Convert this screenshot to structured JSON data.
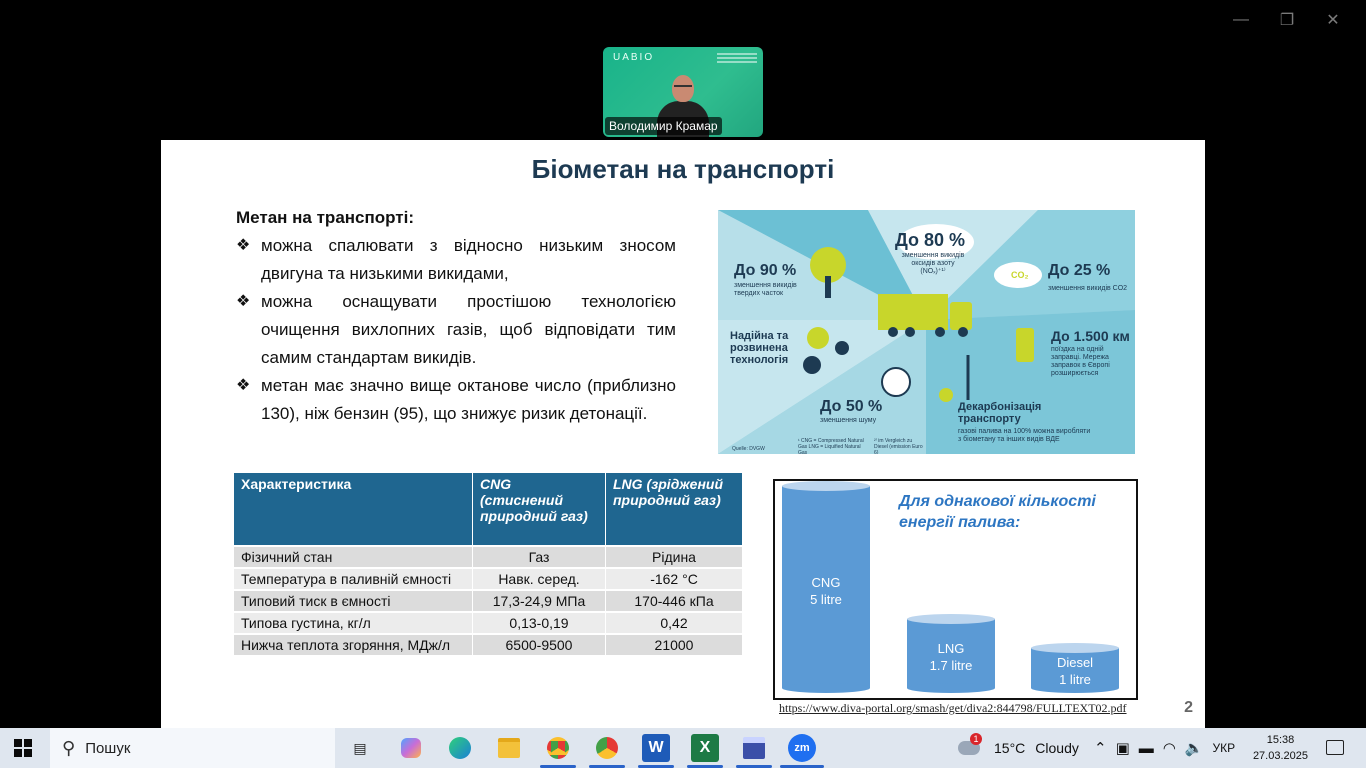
{
  "window": {
    "minimize": "—",
    "restore": "❐",
    "close": "✕"
  },
  "video": {
    "logo": "UABIO",
    "participant_name": "Володимир Крамар"
  },
  "slide": {
    "title": "Біометан на транспорті",
    "intro_heading": "Метан на транспорті:",
    "bullets": [
      "можна спалювати з відносно низьким зносом двигуна та низькими викидами,",
      "можна оснащувати простішою технологією очищення вихлопних газів, щоб відповідати тим самим стандартам викидів.",
      "метан має значно вище октанове число (приблизно 130), ніж бензин (95), що знижує ризик детонації."
    ],
    "bullet_mark": "❖",
    "infographic": {
      "particles_value": "До 90 %",
      "particles_label": "зменшення викидів твердих часток",
      "nox_value": "До 80 %",
      "nox_label": "зменшення викидів оксидів азоту (NOₓ)⁺¹⁾",
      "co2_value": "До 25 %",
      "co2_label": "зменшення викидів CO2",
      "co2_cloud": "CO₂",
      "tech_label": "Надійна та розвинена технологія",
      "range_value": "До 1.500 км",
      "range_label": "поїздка на одній заправці. Мережа заправок в Європі розширюється",
      "noise_value": "До 50 %",
      "noise_label": "зменшення шуму",
      "decarb_title": "Декарбонізація транспорту",
      "decarb_label": "газові палива на 100% можна виробляти з біометану та інших видів ВДЕ",
      "footnote_source": "Quelle: DVGW",
      "footnote_cng": "¹ CNG = Compressed Natural Gas  LNG = Liquified Natural Gas",
      "footnote_ref": "²⁾ im Vergleich zu Diesel (emission Euro 6)"
    },
    "table": {
      "headers": [
        "Характеристика",
        "CNG (стиснений природний газ)",
        "LNG (зріджений природний газ)"
      ],
      "rows": [
        [
          "Фізичний стан",
          "Газ",
          "Рідина"
        ],
        [
          "Температура в паливній ємності",
          "Навк. серед.",
          "-162 °C"
        ],
        [
          "Типовий тиск в ємності",
          "17,3-24,9 МПа",
          "170-446 кПа"
        ],
        [
          "Типова густина, кг/л",
          "0,13-0,19",
          "0,42"
        ],
        [
          "Нижча теплота згоряння, МДж/л",
          "6500-9500",
          "21000"
        ]
      ]
    },
    "fuel_chart": {
      "title": "Для однакової кількості енергії палива:",
      "bars": [
        {
          "name": "CNG",
          "amount": "5 litre",
          "litres": 5
        },
        {
          "name": "LNG",
          "amount": "1.7 litre",
          "litres": 1.7
        },
        {
          "name": "Diesel",
          "amount": "1 litre",
          "litres": 1
        }
      ],
      "colors": {
        "fill": "#5b9ad5",
        "top": "#bcd5ee"
      }
    },
    "source_url": "https://www.diva-portal.org/smash/get/diva2:844798/FULLTEXT02.pdf",
    "page_number": "2"
  },
  "taskbar": {
    "search_placeholder": "Пошук",
    "weather_badge": "1",
    "temperature": "15°C",
    "weather": "Cloudy",
    "language": "УКР",
    "time": "15:38",
    "date": "27.03.2025",
    "apps": [
      "task-view",
      "copilot",
      "edge",
      "file-explorer",
      "chrome",
      "chrome-profile",
      "word",
      "excel",
      "save-app",
      "zoom"
    ],
    "word_letter": "W",
    "excel_letter": "X",
    "zoom_label": "zm"
  }
}
